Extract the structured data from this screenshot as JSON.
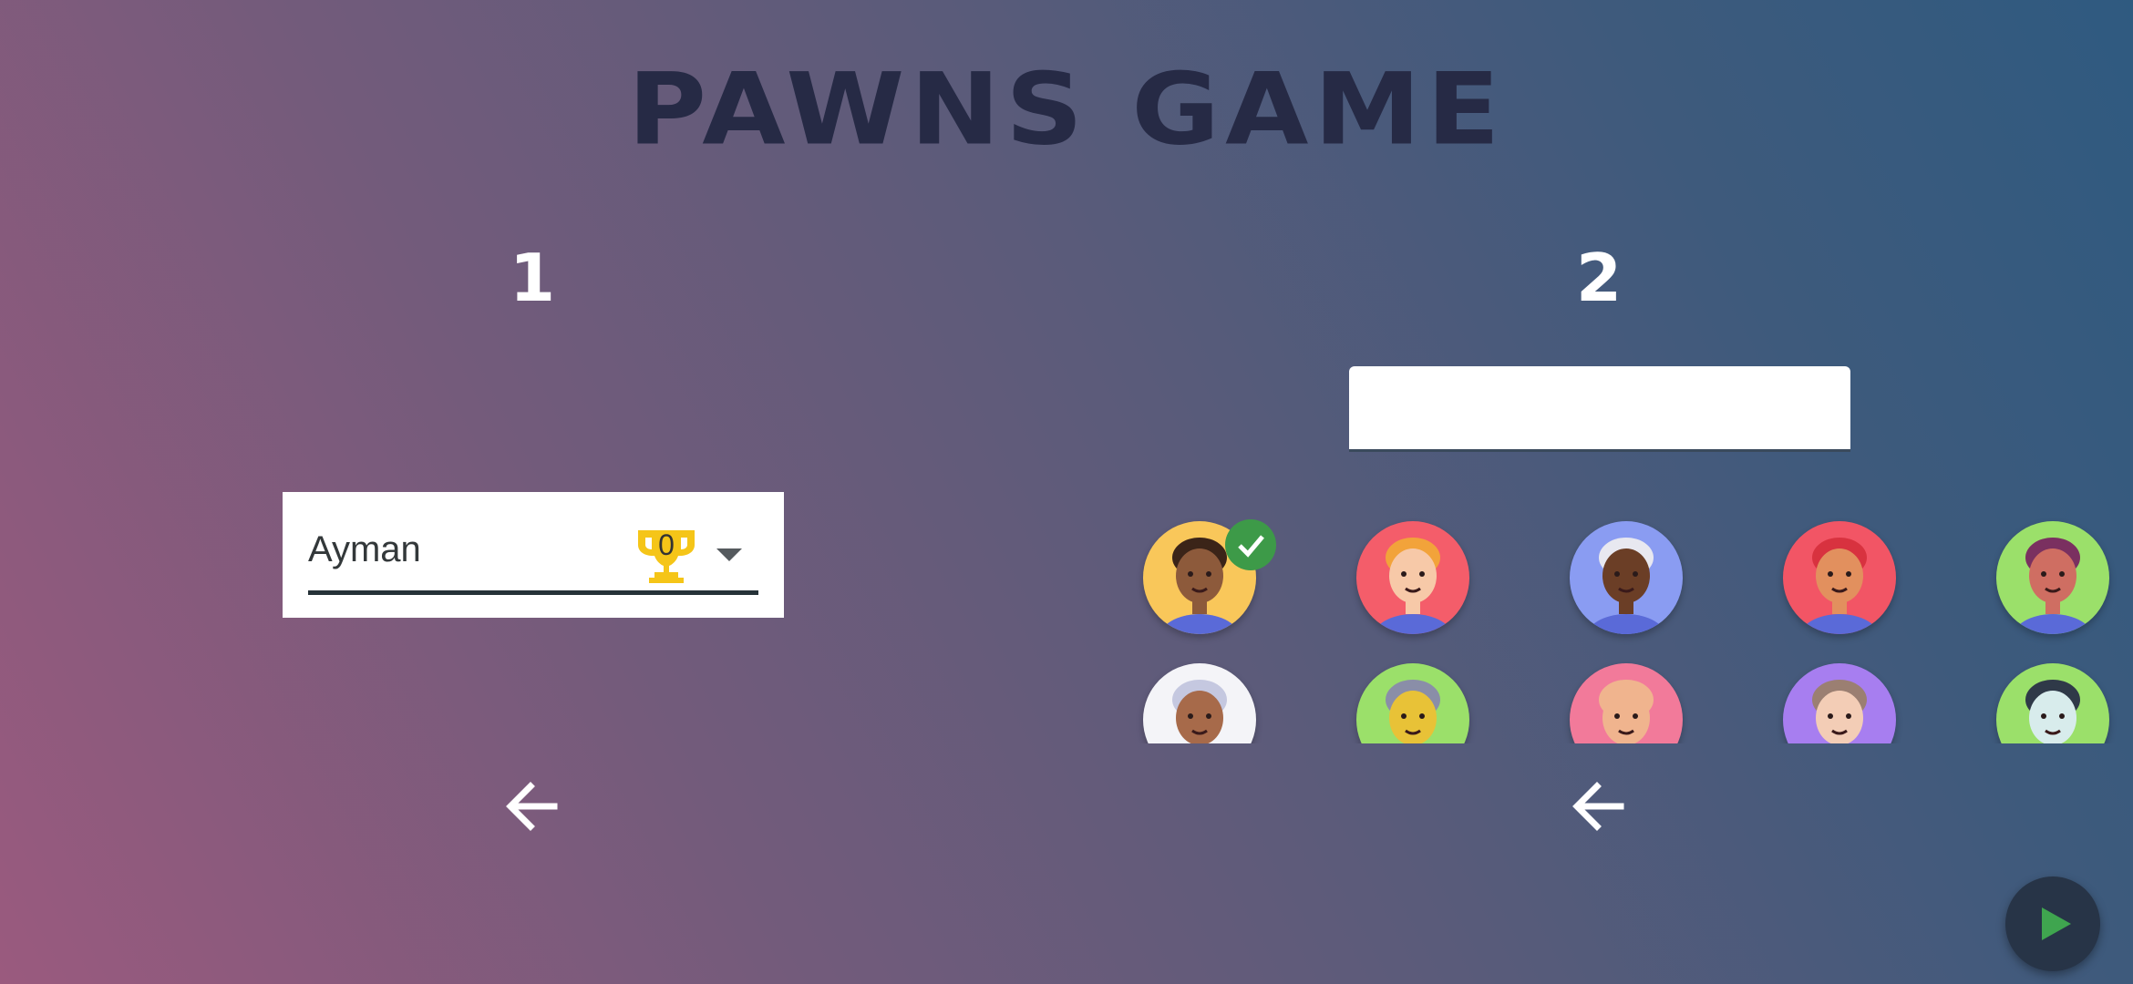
{
  "app": {
    "title": "PAWNS GAME"
  },
  "player1": {
    "number": "1",
    "selected_name": "Ayman",
    "trophy_count": "0",
    "icons": {
      "trophy": "trophy-icon",
      "dropdown": "chevron-down-icon",
      "back": "arrow-left-icon"
    }
  },
  "player2": {
    "number": "2",
    "name_input_value": "",
    "avatars": [
      {
        "id": "avatar-1",
        "bg": "#f9c75a",
        "skin": "#8d5a3b",
        "hair": "#3b2418",
        "selected": true
      },
      {
        "id": "avatar-2",
        "bg": "#f45d6a",
        "skin": "#f7c9a8",
        "hair": "#f2a33a",
        "selected": false
      },
      {
        "id": "avatar-3",
        "bg": "#8a9cf2",
        "skin": "#6b3e26",
        "hair": "#e8e8f0",
        "selected": false
      },
      {
        "id": "avatar-4",
        "bg": "#f25565",
        "skin": "#e2905e",
        "hair": "#d8323f",
        "selected": false
      },
      {
        "id": "avatar-5",
        "bg": "#9be06a",
        "skin": "#cf6e62",
        "hair": "#7a3060",
        "selected": false
      },
      {
        "id": "avatar-6",
        "bg": "#f4f4f8",
        "skin": "#a76a4a",
        "hair": "#c5c8e0",
        "selected": false
      },
      {
        "id": "avatar-7",
        "bg": "#9be06a",
        "skin": "#e8c237",
        "hair": "#8a8ea8",
        "selected": false
      },
      {
        "id": "avatar-8",
        "bg": "#f27a9a",
        "skin": "#f0b48e",
        "hair": "#f0b48e",
        "selected": false
      },
      {
        "id": "avatar-9",
        "bg": "#a77ef0",
        "skin": "#f3cdb6",
        "hair": "#9b7f72",
        "selected": false
      },
      {
        "id": "avatar-10",
        "bg": "#9be06a",
        "skin": "#d8ecec",
        "hair": "#2f3948",
        "selected": false
      }
    ],
    "icons": {
      "check": "check-icon",
      "back": "arrow-left-icon"
    }
  },
  "controls": {
    "play_icon": "play-icon"
  },
  "colors": {
    "title": "#262a45",
    "play_triangle": "#3fa54f",
    "check_badge": "#3d9a48",
    "trophy": "#f5c518"
  }
}
